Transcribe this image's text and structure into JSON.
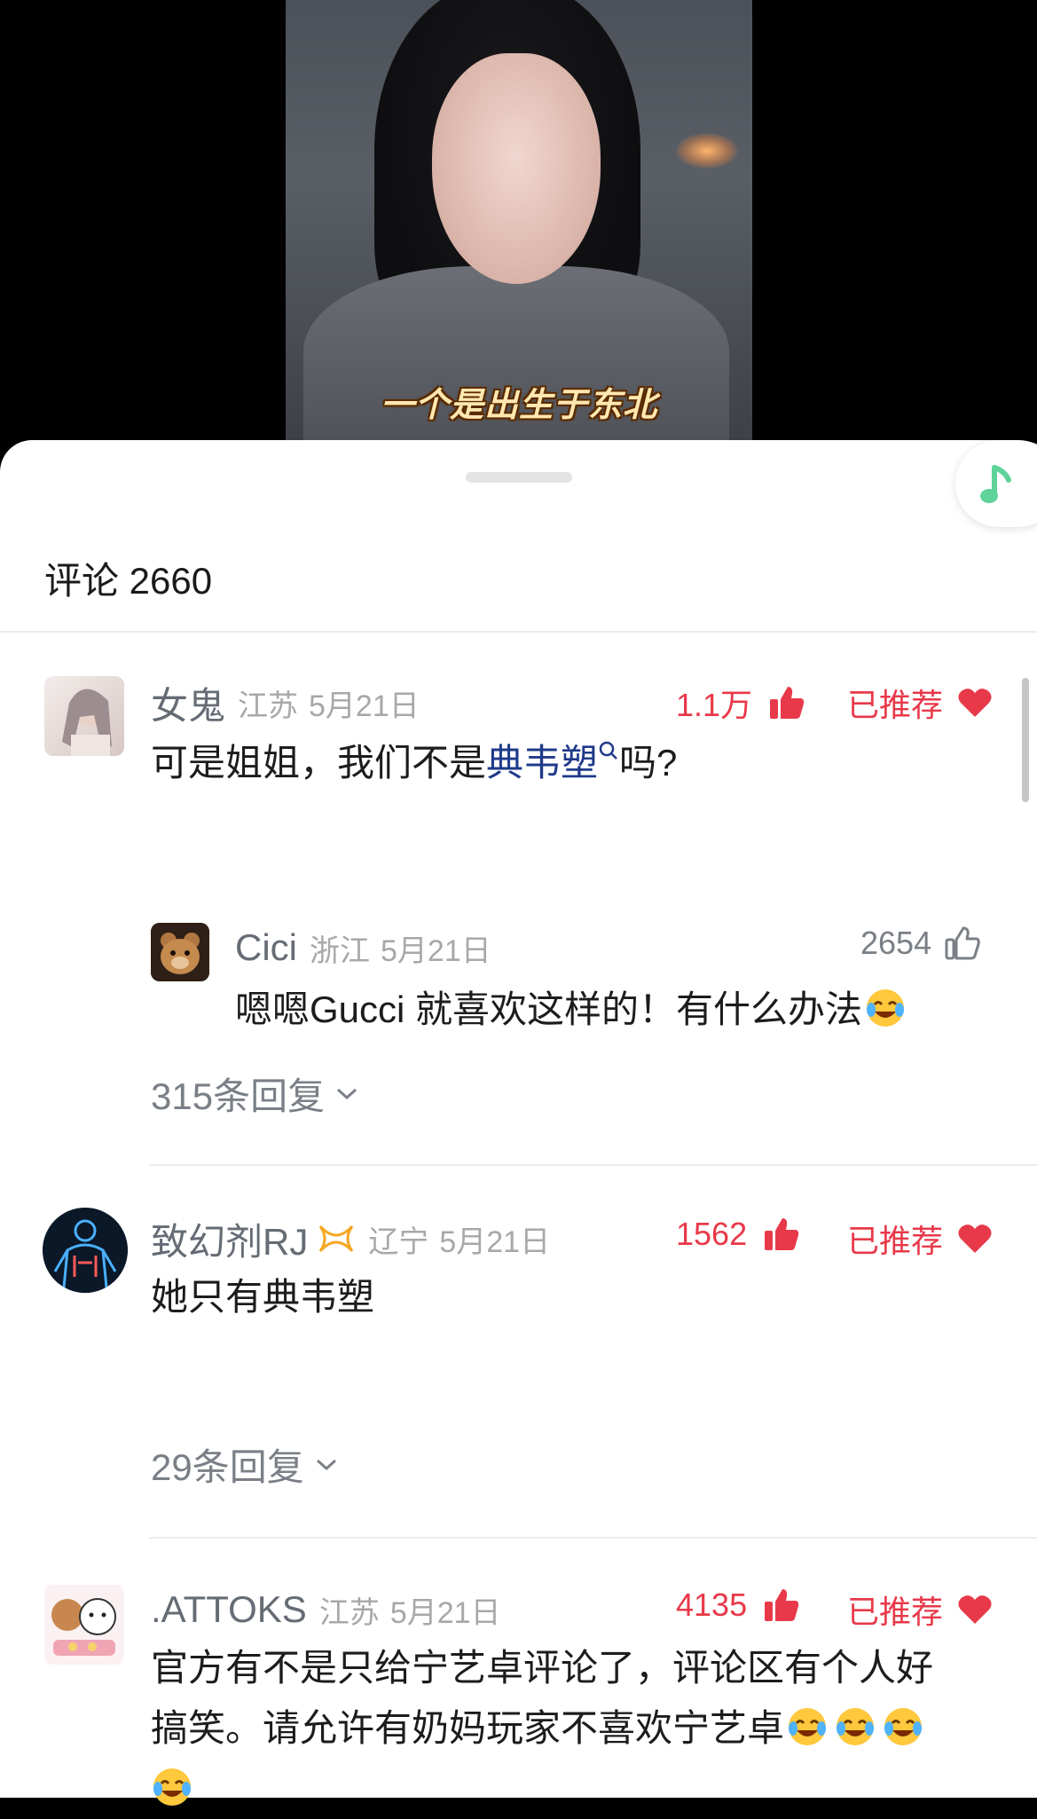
{
  "video": {
    "subtitle": "一个是出生于东北"
  },
  "sheet": {
    "title": "评论 2660"
  },
  "comments": [
    {
      "username": "女鬼",
      "location": "江苏",
      "date": "5月21日",
      "likes": "1.1万",
      "recommend_label": "已推荐",
      "text_before": "可是姐姐，我们不是",
      "keyword": "典韦塑",
      "text_after": "吗?",
      "reply": {
        "username": "Cici",
        "location": "浙江",
        "date": "5月21日",
        "likes": "2654",
        "text": "嗯嗯Gucci 就喜欢这样的！有什么办法"
      },
      "replies_toggle": "315条回复"
    },
    {
      "username": "致幻剂RJ",
      "location": "辽宁",
      "date": "5月21日",
      "likes": "1562",
      "recommend_label": "已推荐",
      "text": "她只有典韦塑",
      "replies_toggle": "29条回复"
    },
    {
      "username": ".ATTOKS",
      "location": "江苏",
      "date": "5月21日",
      "likes": "4135",
      "recommend_label": "已推荐",
      "text_line1": "官方有不是只给宁艺卓评论了，评论区有个人好",
      "text_line2": "搞笑。请允许有奶妈玩家不喜欢宁艺卓"
    }
  ],
  "colors": {
    "accent_red": "#e8394a",
    "keyword_blue": "#1f3a8a",
    "music_green": "#5ed39a"
  },
  "icons": [
    "thumbs-up-filled-icon",
    "thumbs-up-outline-icon",
    "heart-icon",
    "search-small-icon",
    "chevron-down-icon",
    "music-note-icon",
    "laugh-cry-emoji-icon"
  ]
}
